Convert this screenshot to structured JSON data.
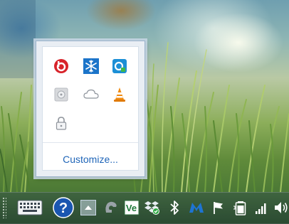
{
  "flyout": {
    "customize_label": "Customize...",
    "icons": [
      {
        "name": "beats-audio-icon"
      },
      {
        "name": "snowflake-icon"
      },
      {
        "name": "app-status-icon"
      },
      {
        "name": "disc-drive-icon"
      },
      {
        "name": "cloud-icon"
      },
      {
        "name": "vlc-cone-icon"
      },
      {
        "name": "lock-icon"
      }
    ]
  },
  "taskbar": {
    "icons": [
      {
        "name": "touch-keyboard-icon"
      },
      {
        "name": "help-icon"
      },
      {
        "name": "show-hidden-icons-chevron"
      },
      {
        "name": "gray-app-icon"
      },
      {
        "name": "ve-app-icon"
      },
      {
        "name": "dropbox-icon"
      },
      {
        "name": "bluetooth-icon"
      },
      {
        "name": "blue-app-icon"
      },
      {
        "name": "action-center-flag-icon"
      },
      {
        "name": "battery-icon"
      },
      {
        "name": "network-signal-icon"
      },
      {
        "name": "volume-icon"
      }
    ]
  },
  "colors": {
    "link": "#1f65b8",
    "flyout_border": "#9bb3cc",
    "beats_red": "#d8232a",
    "snowflake_blue": "#1b74c9",
    "vlc_orange": "#f08a10"
  }
}
